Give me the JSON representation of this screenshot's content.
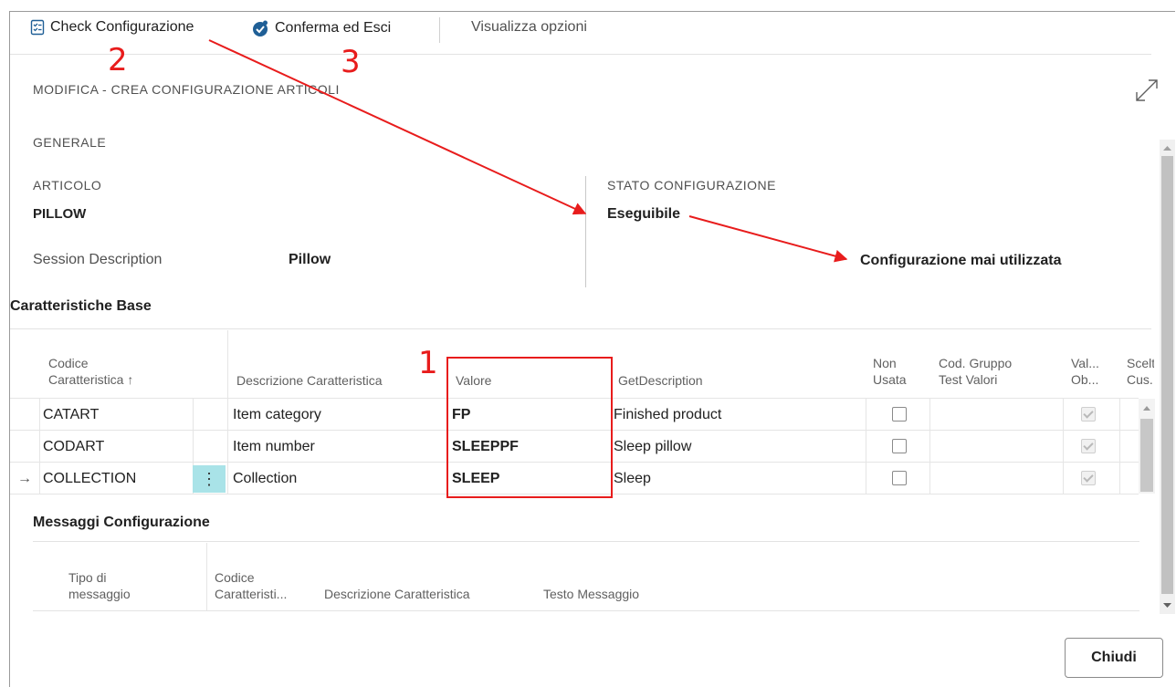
{
  "toolbar": {
    "check_label": "Check Configurazione",
    "conferma_label": "Conferma ed Esci",
    "visualizza_label": "Visualizza opzioni"
  },
  "annotations": {
    "n1": "1",
    "n2": "2",
    "n3": "3"
  },
  "page": {
    "title": "MODIFICA - CREA CONFIGURAZIONE ARTICOLI",
    "section_generale": "GENERALE"
  },
  "generale": {
    "articolo_label": "ARTICOLO",
    "articolo_value": "PILLOW",
    "session_desc_label": "Session Description",
    "session_desc_value": "Pillow",
    "stato_label": "STATO CONFIGURAZIONE",
    "stato_value": "Eseguibile",
    "stato_note": "Configurazione mai utilizzata"
  },
  "caratteristiche": {
    "title": "Caratteristiche Base",
    "headers": {
      "codice_line1": "Codice",
      "codice_line2": "Caratteristica ↑",
      "descrizione": "Descrizione Caratteristica",
      "valore": "Valore",
      "getdesc": "GetDescription",
      "non_line1": "Non",
      "non_line2": "Usata",
      "gruppo_line1": "Cod. Gruppo",
      "gruppo_line2": "Test Valori",
      "val_line1": "Val...",
      "val_line2": "Ob...",
      "scelta_line1": "Scelta",
      "scelta_line2": "Cus..."
    },
    "rows": [
      {
        "codice": "CATART",
        "descrizione": "Item category",
        "valore": "FP",
        "getdesc": "Finished product"
      },
      {
        "codice": "CODART",
        "descrizione": "Item number",
        "valore": "SLEEPPF",
        "getdesc": "Sleep pillow"
      },
      {
        "codice": "COLLECTION",
        "descrizione": "Collection",
        "valore": "SLEEP",
        "getdesc": "Sleep"
      }
    ],
    "current_row_marker": "→",
    "row_menu": "⋮"
  },
  "messaggi": {
    "title": "Messaggi Configurazione",
    "headers": {
      "tipo_line1": "Tipo di",
      "tipo_line2": "messaggio",
      "codice_line1": "Codice",
      "codice_line2": "Caratteristi...",
      "descrizione": "Descrizione Caratteristica",
      "testo": "Testo Messaggio"
    }
  },
  "footer": {
    "chiudi_label": "Chiudi"
  },
  "colors": {
    "annotation_red": "#e81c1c",
    "selected_cell": "#a9e3e8"
  }
}
